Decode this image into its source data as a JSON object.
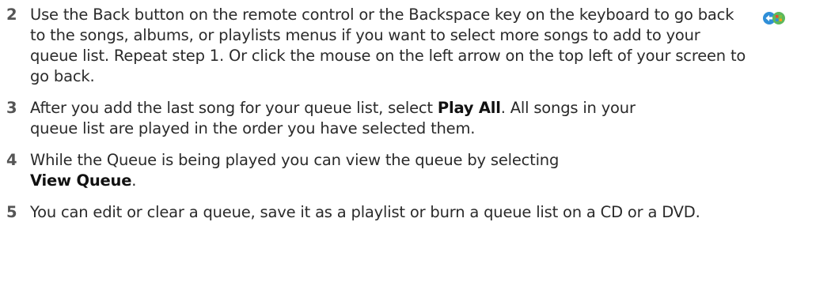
{
  "icon": {
    "name": "back-arrow-windows-icon",
    "colors": [
      "#2f8fd8",
      "#5cb85c",
      "#f4a11a"
    ]
  },
  "steps": [
    {
      "number": "2",
      "text": "Use the Back button on the remote control or the Backspace key on the keyboard to go back to the songs, albums, or playlists menus if you want to select more songs to add to your queue list. Repeat step 1. Or click the mouse on the left arrow on the top left of your screen to go back."
    },
    {
      "number": "3",
      "text_before": "After you add the last song for your queue list, select ",
      "bold": "Play All",
      "text_after": ". All songs in your queue list are played in the order you have selected them."
    },
    {
      "number": "4",
      "text_before": "While the Queue is being played you can view the queue by selecting ",
      "bold": "View Queue",
      "text_after": "."
    },
    {
      "number": "5",
      "text": "You can edit or clear a queue, save it as a playlist or burn a queue list on a CD or a DVD."
    }
  ]
}
